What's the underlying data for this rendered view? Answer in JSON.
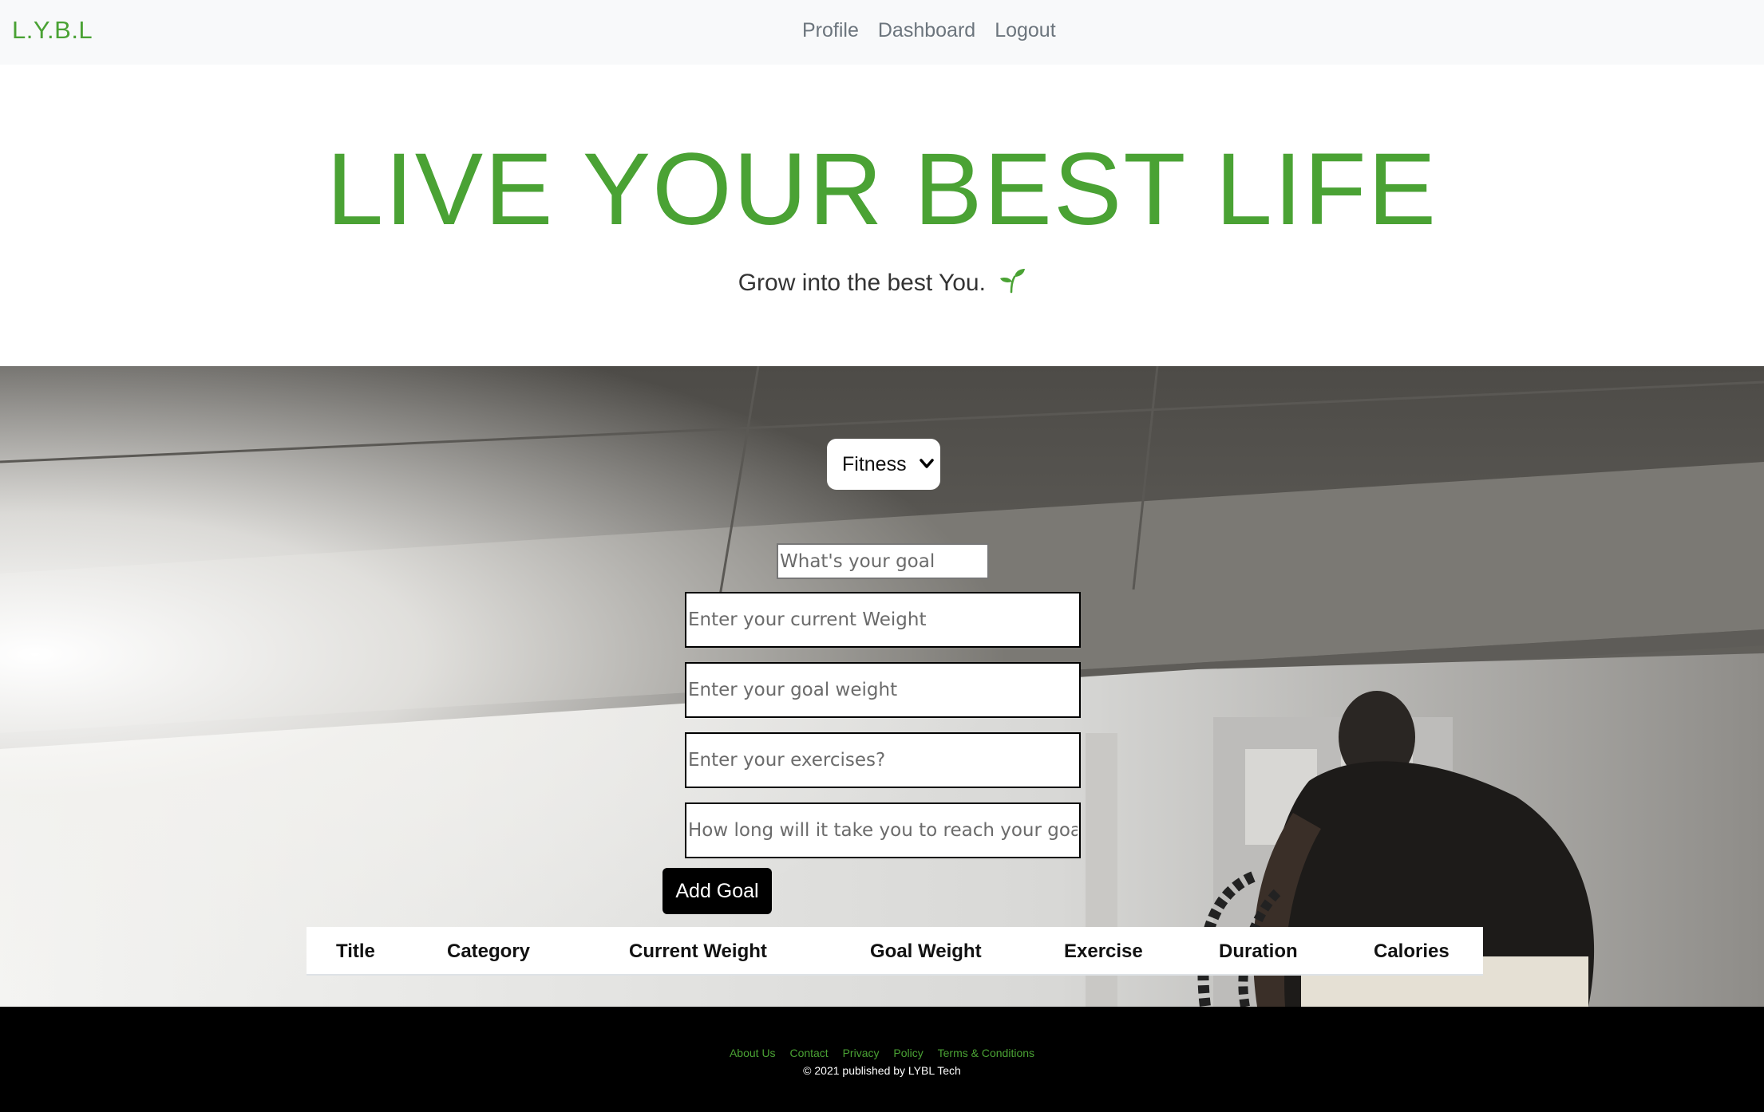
{
  "nav": {
    "brand": "L.Y.B.L",
    "links": [
      "Profile",
      "Dashboard",
      "Logout"
    ]
  },
  "hero": {
    "title": "LIVE YOUR BEST LIFE",
    "subtitle": "Grow into the best You.",
    "subtitle_icon": "sprout-icon"
  },
  "form": {
    "category_selected": "Fitness",
    "goal_placeholder": "What's your goal",
    "current_weight_placeholder": "Enter your current Weight",
    "goal_weight_placeholder": "Enter your goal weight",
    "exercises_placeholder": "Enter your exercises?",
    "duration_placeholder": "How long will it take you to reach your goal?",
    "submit_label": "Add Goal"
  },
  "table": {
    "headers": [
      "Title",
      "Category",
      "Current Weight",
      "Goal Weight",
      "Exercise",
      "Duration",
      "Calories"
    ]
  },
  "footer": {
    "links": [
      "About Us",
      "Contact",
      "Privacy",
      "Policy",
      "Terms & Conditions"
    ],
    "copyright": "© 2021 published by LYBL Tech"
  },
  "colors": {
    "brand_green": "#4aa234",
    "navbar_bg": "#f8f9fa",
    "footer_bg": "#000000"
  }
}
